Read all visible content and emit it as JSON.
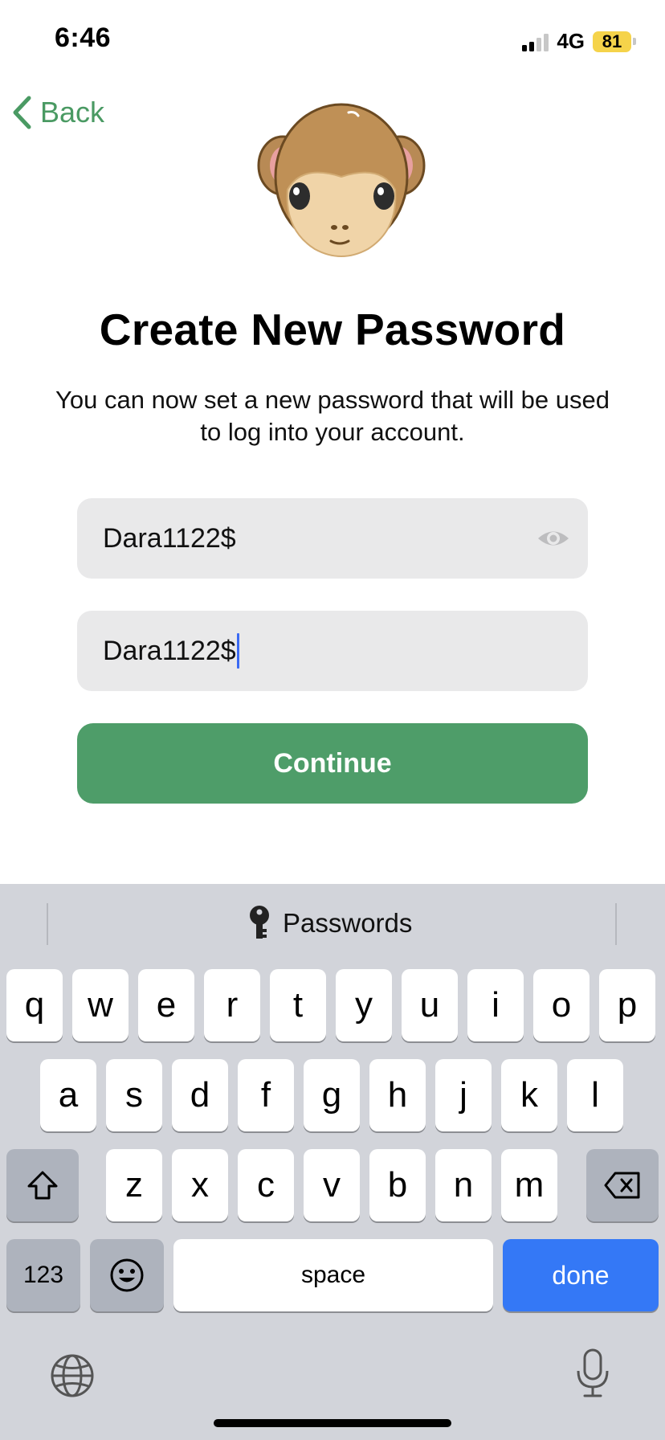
{
  "status_bar": {
    "time": "6:46",
    "network": "4G",
    "battery": "81"
  },
  "nav": {
    "back_label": "Back"
  },
  "header": {
    "title": "Create New Password",
    "subtitle": "You can now set a new password that will be used to log into your account."
  },
  "form": {
    "password_value": "Dara1122$",
    "confirm_value": "Dara1122$",
    "continue_label": "Continue"
  },
  "keyboard": {
    "suggestion_label": "Passwords",
    "row1": [
      "q",
      "w",
      "e",
      "r",
      "t",
      "y",
      "u",
      "i",
      "o",
      "p"
    ],
    "row2": [
      "a",
      "s",
      "d",
      "f",
      "g",
      "h",
      "j",
      "k",
      "l"
    ],
    "row3": [
      "z",
      "x",
      "c",
      "v",
      "b",
      "n",
      "m"
    ],
    "numbers_label": "123",
    "space_label": "space",
    "done_label": "done"
  },
  "colors": {
    "accent": "#4e9d69",
    "back": "#4a9a63",
    "done": "#3478f6",
    "field_bg": "#e9e9ea"
  }
}
